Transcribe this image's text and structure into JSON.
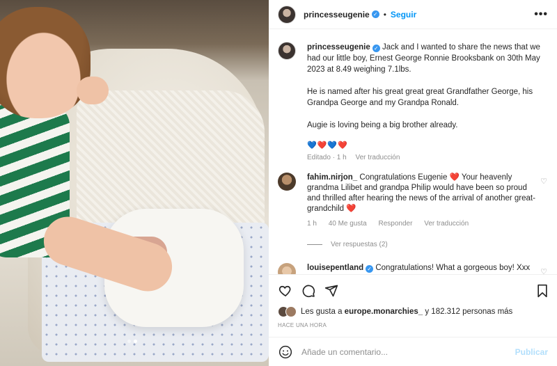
{
  "post": {
    "username": "princesseugenie",
    "follow_label": "Seguir",
    "more_label": "•••",
    "caption_paragraphs": [
      "Jack and I wanted to share the news that we had our little boy, Ernest George Ronnie Brooksbank on 30th May 2023 at 8.49 weighing 7.1lbs.",
      "He is named after his great great great Grandfather George, his Grandpa George and my Grandpa Ronald.",
      "Augie is loving being a big brother already."
    ],
    "caption_emojis": "💙❤️💙❤️",
    "edited_label": "Editado · 1 h",
    "see_translation": "Ver traducción"
  },
  "comments": [
    {
      "username": "fahim.nirjon_",
      "text": "Congratulations Eugenie ❤️ Your heavenly grandma Lilibet and grandpa Philip would have been so proud and thrilled after hearing the news of the arrival of another great-grandchild ❤️",
      "time": "1 h",
      "likes": "40 Me gusta",
      "reply_label": "Responder",
      "translate_label": "Ver traducción",
      "view_replies": "Ver respuestas (2)"
    },
    {
      "username": "louisepentland",
      "text": "Congratulations! What a gorgeous boy! Xxx"
    }
  ],
  "footer": {
    "likes_prefix": "Les gusta a",
    "likes_user": "europe.monarchies_",
    "likes_suffix": "y 182.312 personas más",
    "timestamp": "HACE UNA HORA",
    "comment_placeholder": "Añade un comentario...",
    "publish_label": "Publicar"
  },
  "colors": {
    "accent": "#0095f6",
    "heart": "#e0245e",
    "muted": "#8e8e8e"
  },
  "icons": [
    "heart-icon",
    "comment-icon",
    "share-icon",
    "save-icon",
    "emoji-icon",
    "verified-icon"
  ]
}
